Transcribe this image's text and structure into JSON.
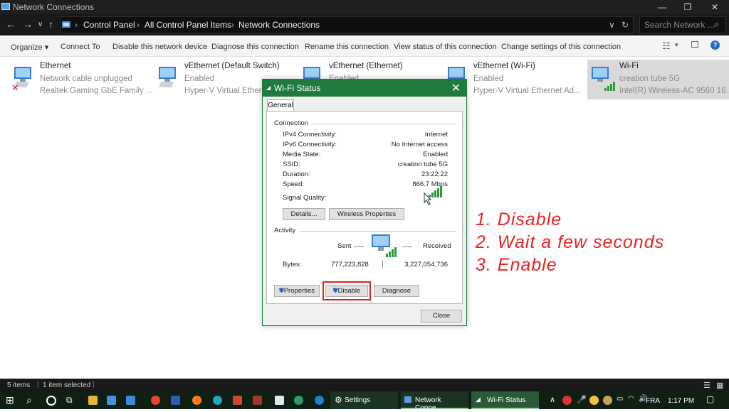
{
  "window": {
    "title": "Network Connections",
    "minimize": "—",
    "maximize": "❐",
    "close": "✕"
  },
  "address": {
    "crumbs": [
      "Control Panel",
      "All Control Panel Items",
      "Network Connections"
    ],
    "search_placeholder": "Search Network ..."
  },
  "commands": [
    "Organize ▾",
    "Connect To",
    "Disable this network device",
    "Diagnose this connection",
    "Rename this connection",
    "View status of this connection",
    "Change settings of this connection"
  ],
  "connections": [
    {
      "name": "Ethernet",
      "status": "Network cable unplugged",
      "device": "Realtek Gaming GbE Family ..."
    },
    {
      "name": "vEthernet (Default Switch)",
      "status": "Enabled",
      "device": "Hyper-V Virtual Ethern"
    },
    {
      "name": "vEthernet (Ethernet)",
      "status": "Enabled",
      "device": ""
    },
    {
      "name": "vEthernet (Wi-Fi)",
      "status": "Enabled",
      "device": "Hyper-V Virtual Ethernet Ad..."
    },
    {
      "name": "Wi-Fi",
      "status": "creation tube 5G",
      "device": "Intel(R) Wireless-AC 9560 16..."
    }
  ],
  "dialog": {
    "title": "Wi-Fi Status",
    "tab": "General",
    "connection_heading": "Connection",
    "rows": [
      {
        "label": "IPv4 Connectivity:",
        "value": "Internet"
      },
      {
        "label": "IPv6 Connectivity:",
        "value": "No Internet access"
      },
      {
        "label": "Media State:",
        "value": "Enabled"
      },
      {
        "label": "SSID:",
        "value": "creation tube 5G"
      },
      {
        "label": "Duration:",
        "value": "23:22:22"
      },
      {
        "label": "Speed:",
        "value": "866.7 Mbps"
      }
    ],
    "signal_label": "Signal Quality:",
    "details_button": "Details...",
    "wireless_button": "Wireless Properties",
    "activity_heading": "Activity",
    "sent_label": "Sent",
    "received_label": "Received",
    "bytes_label": "Bytes:",
    "bytes_sent": "777,223,828",
    "bytes_received": "3,227,054,736",
    "properties_button": "Properties",
    "disable_button": "Disable",
    "diagnose_button": "Diagnose",
    "close_button": "Close"
  },
  "annotation": [
    "1. Disable",
    "2. Wait a few seconds",
    "3. Enable"
  ],
  "statusbar": {
    "items": "5 items",
    "selected": "1 item selected"
  },
  "taskbar": {
    "settings": "Settings",
    "network": "Network Conne...",
    "wifi_status": "Wi-Fi Status",
    "lang": "FRA",
    "time": "1:17 PM"
  },
  "colors": {
    "accent_green": "#1f7a3e",
    "annotation_red": "#e8231f",
    "highlight_red": "#e02020"
  }
}
